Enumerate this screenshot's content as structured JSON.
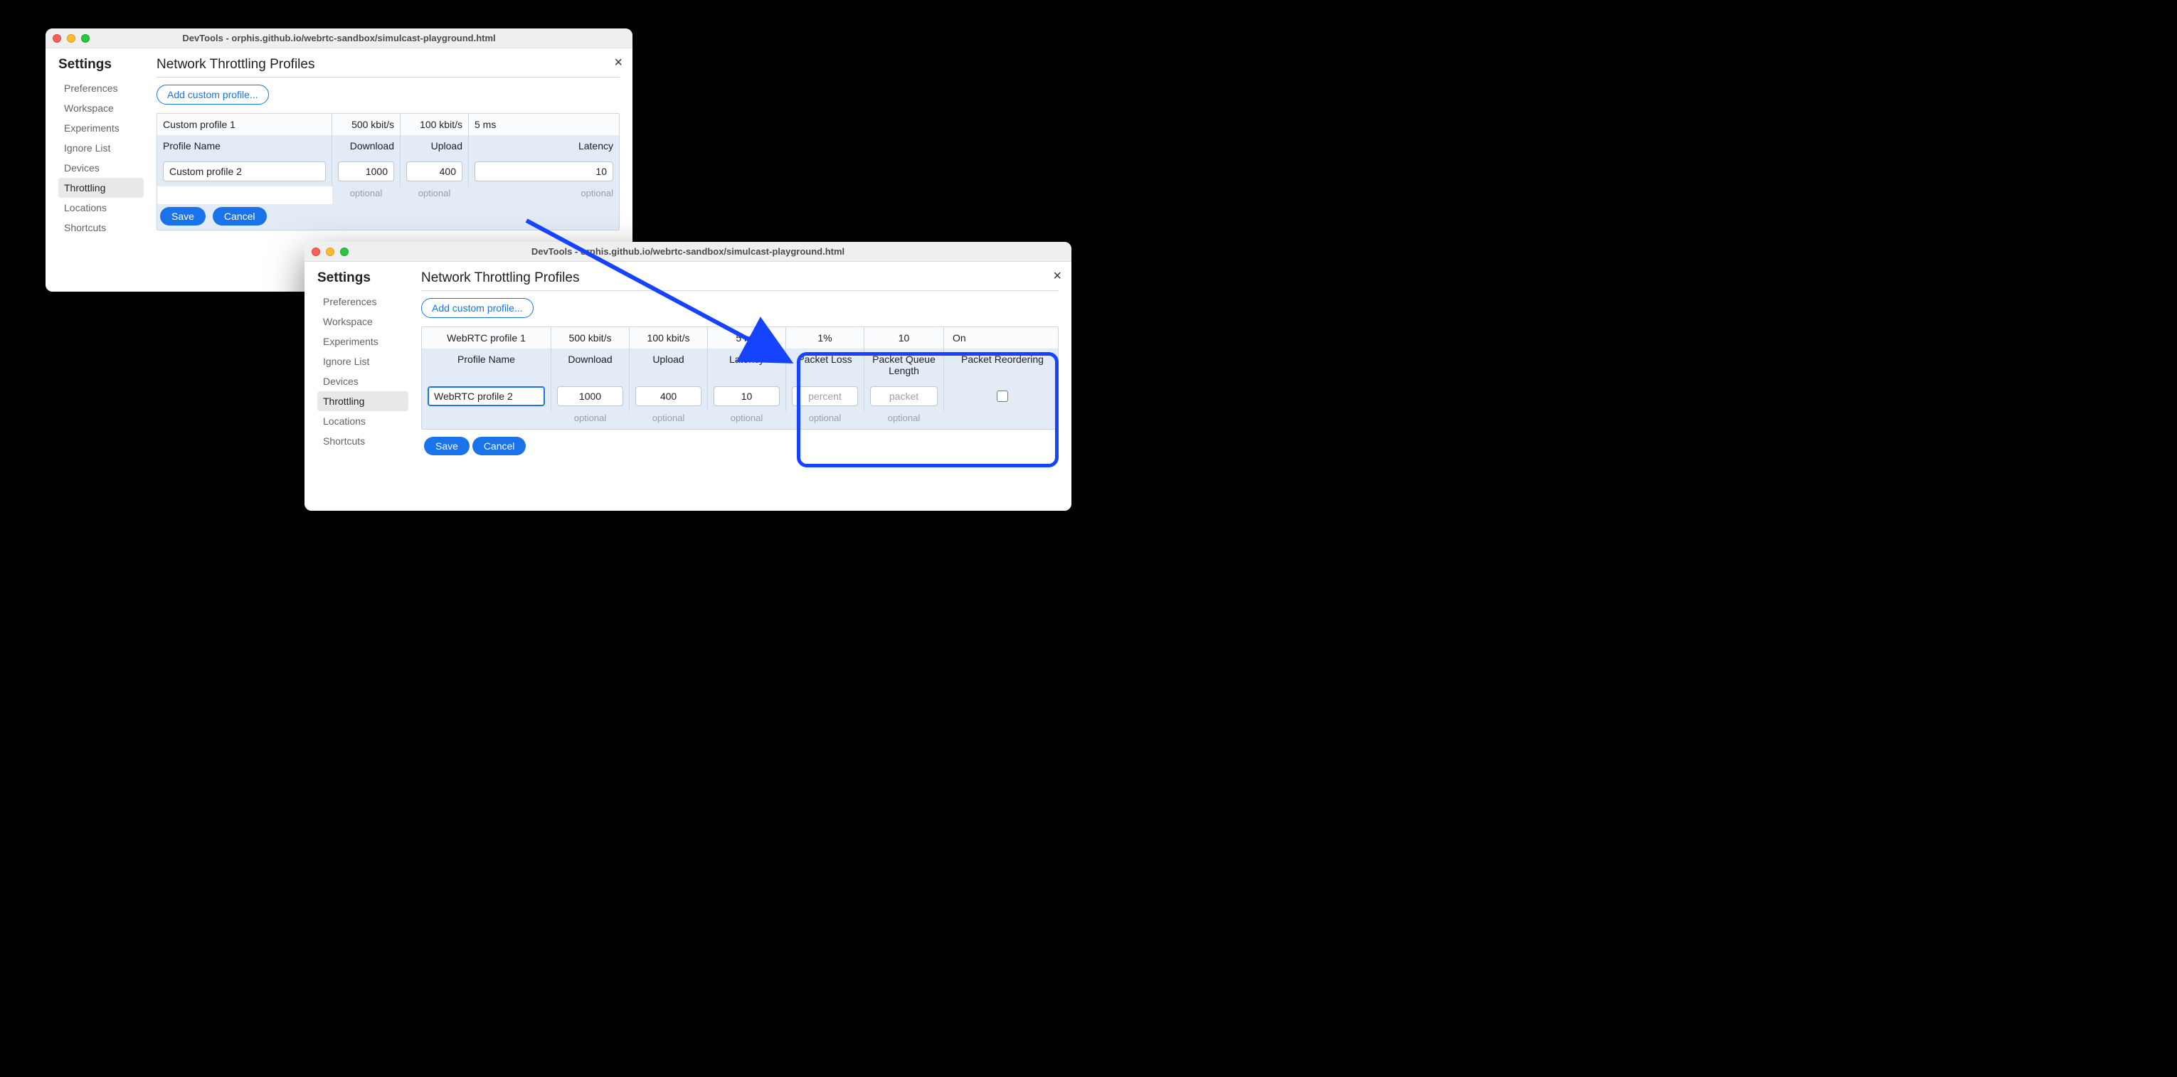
{
  "window1": {
    "title": "DevTools - orphis.github.io/webrtc-sandbox/simulcast-playground.html",
    "settings_label": "Settings",
    "nav": {
      "preferences": "Preferences",
      "workspace": "Workspace",
      "experiments": "Experiments",
      "ignore": "Ignore List",
      "devices": "Devices",
      "throttling": "Throttling",
      "locations": "Locations",
      "shortcuts": "Shortcuts"
    },
    "heading": "Network Throttling Profiles",
    "add_label": "Add custom profile...",
    "headers": {
      "name": "Profile Name",
      "download": "Download",
      "upload": "Upload",
      "latency": "Latency"
    },
    "row1": {
      "name": "Custom profile 1",
      "download": "500 kbit/s",
      "upload": "100 kbit/s",
      "latency": "5 ms"
    },
    "edit": {
      "name": "Custom profile 2",
      "download": "1000",
      "upload": "400",
      "latency": "10"
    },
    "optional": "optional",
    "save": "Save",
    "cancel": "Cancel"
  },
  "window2": {
    "title": "DevTools - orphis.github.io/webrtc-sandbox/simulcast-playground.html",
    "settings_label": "Settings",
    "nav": {
      "preferences": "Preferences",
      "workspace": "Workspace",
      "experiments": "Experiments",
      "ignore": "Ignore List",
      "devices": "Devices",
      "throttling": "Throttling",
      "locations": "Locations",
      "shortcuts": "Shortcuts"
    },
    "heading": "Network Throttling Profiles",
    "add_label": "Add custom profile...",
    "headers": {
      "name": "Profile Name",
      "download": "Download",
      "upload": "Upload",
      "latency": "Latency",
      "packet_loss": "Packet Loss",
      "packet_queue": "Packet Queue Length",
      "packet_reorder": "Packet Reordering"
    },
    "row1": {
      "name": "WebRTC profile 1",
      "download": "500 kbit/s",
      "upload": "100 kbit/s",
      "latency": "5 ms",
      "packet_loss": "1%",
      "packet_queue": "10",
      "packet_reorder": "On"
    },
    "edit": {
      "name": "WebRTC profile 2",
      "download": "1000",
      "upload": "400",
      "latency": "10",
      "packet_loss_ph": "percent",
      "packet_queue_ph": "packet"
    },
    "optional": "optional",
    "save": "Save",
    "cancel": "Cancel"
  }
}
